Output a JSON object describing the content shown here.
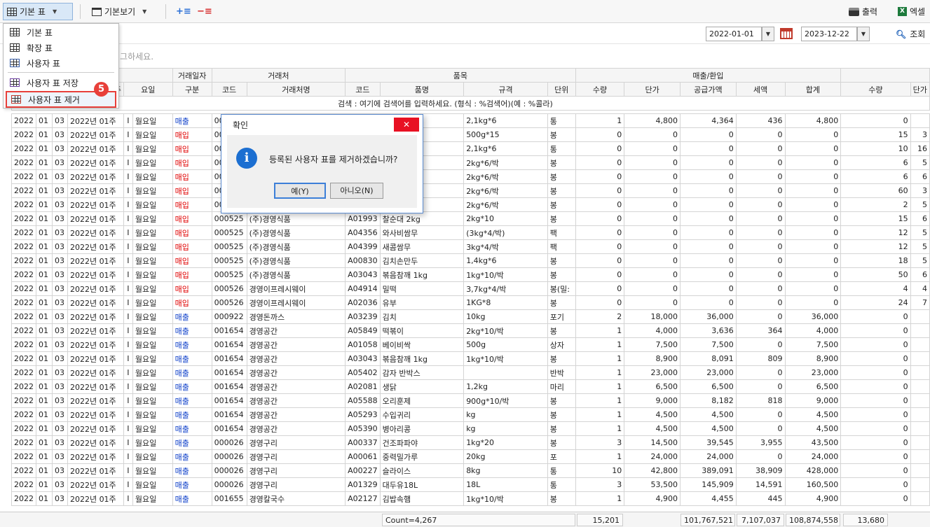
{
  "toolbar": {
    "table_label": "기본 표",
    "view_label": "기본보기",
    "print_label": "출력",
    "excel_label": "엑셀"
  },
  "date_filter": {
    "start": "2022-01-01",
    "end": "2023-12-22",
    "search_label": "조회"
  },
  "group_hint": "래그하세요.",
  "menu": {
    "items": [
      {
        "label": "기본 표"
      },
      {
        "label": "확장 표"
      },
      {
        "label": "사용자 표"
      },
      {
        "label": "사용자 표 저장"
      },
      {
        "label": "사용자 표 제거"
      }
    ],
    "step_badge": "5"
  },
  "table": {
    "group_headers": [
      "거래일자",
      "거래처",
      "품목",
      "매출/환입"
    ],
    "columns": [
      "주",
      "요일",
      "구분",
      "코드",
      "거래처명",
      "코드",
      "품명",
      "규격",
      "단위",
      "수량",
      "단가",
      "공급가액",
      "세액",
      "합계",
      "수량",
      "단가"
    ],
    "search_hint": "검색 : 여기에 검색어를 입력하세요. (형식 : %검색어)(예 : %콜라)",
    "rows": [
      [
        "2022",
        "01",
        "03",
        "2022년 01주",
        "I",
        "월요일",
        "매출",
        "000",
        "",
        "",
        "",
        "2,1kg*6",
        "통",
        "1",
        "4,800",
        "4,364",
        "436",
        "4,800",
        "0",
        ""
      ],
      [
        "2022",
        "01",
        "03",
        "2022년 01주",
        "I",
        "월요일",
        "매입",
        "000",
        "",
        "",
        "즈",
        "500g*15",
        "봉",
        "0",
        "0",
        "0",
        "0",
        "0",
        "15",
        "3"
      ],
      [
        "2022",
        "01",
        "03",
        "2022년 01주",
        "I",
        "월요일",
        "매입",
        "000",
        "",
        "",
        "",
        "2,1kg*6",
        "통",
        "0",
        "0",
        "0",
        "0",
        "0",
        "10",
        "16"
      ],
      [
        "2022",
        "01",
        "03",
        "2022년 01주",
        "I",
        "월요일",
        "매입",
        "000",
        "",
        "",
        "",
        "2kg*6/박",
        "봉",
        "0",
        "0",
        "0",
        "0",
        "0",
        "6",
        "5"
      ],
      [
        "2022",
        "01",
        "03",
        "2022년 01주",
        "I",
        "월요일",
        "매입",
        "000",
        "",
        "",
        "트",
        "2kg*6/박",
        "봉",
        "0",
        "0",
        "0",
        "0",
        "0",
        "6",
        "6"
      ],
      [
        "2022",
        "01",
        "03",
        "2022년 01주",
        "I",
        "월요일",
        "매입",
        "000",
        "",
        "",
        "타",
        "2kg*6/박",
        "봉",
        "0",
        "0",
        "0",
        "0",
        "0",
        "60",
        "3"
      ],
      [
        "2022",
        "01",
        "03",
        "2022년 01주",
        "I",
        "월요일",
        "매입",
        "000",
        "",
        "",
        "타",
        "2kg*6/박",
        "봉",
        "0",
        "0",
        "0",
        "0",
        "0",
        "2",
        "5"
      ],
      [
        "2022",
        "01",
        "03",
        "2022년 01주",
        "I",
        "월요일",
        "매입",
        "000525",
        "(주)경영식품",
        "A01993",
        "찰순대 2kg",
        "2kg*10",
        "봉",
        "0",
        "0",
        "0",
        "0",
        "0",
        "15",
        "6"
      ],
      [
        "2022",
        "01",
        "03",
        "2022년 01주",
        "I",
        "월요일",
        "매입",
        "000525",
        "(주)경영식품",
        "A04356",
        "와사비쌈무",
        "(3kg*4/박)",
        "팩",
        "0",
        "0",
        "0",
        "0",
        "0",
        "12",
        "5"
      ],
      [
        "2022",
        "01",
        "03",
        "2022년 01주",
        "I",
        "월요일",
        "매입",
        "000525",
        "(주)경영식품",
        "A04399",
        "새콤쌈무",
        "3kg*4/박",
        "팩",
        "0",
        "0",
        "0",
        "0",
        "0",
        "12",
        "5"
      ],
      [
        "2022",
        "01",
        "03",
        "2022년 01주",
        "I",
        "월요일",
        "매입",
        "000525",
        "(주)경영식품",
        "A00830",
        "김치손만두",
        "1,4kg*6",
        "봉",
        "0",
        "0",
        "0",
        "0",
        "0",
        "18",
        "5"
      ],
      [
        "2022",
        "01",
        "03",
        "2022년 01주",
        "I",
        "월요일",
        "매입",
        "000525",
        "(주)경영식품",
        "A03043",
        "볶음참깨 1kg",
        "1kg*10/박",
        "봉",
        "0",
        "0",
        "0",
        "0",
        "0",
        "50",
        "6"
      ],
      [
        "2022",
        "01",
        "03",
        "2022년 01주",
        "I",
        "월요일",
        "매입",
        "000526",
        "경영이프레시웨이",
        "A04914",
        "밀떡",
        "3,7kg*4/박",
        "봉(밀:",
        "0",
        "0",
        "0",
        "0",
        "0",
        "4",
        "4"
      ],
      [
        "2022",
        "01",
        "03",
        "2022년 01주",
        "I",
        "월요일",
        "매입",
        "000526",
        "경영이프레시웨이",
        "A02036",
        "유부",
        "1KG*8",
        "봉",
        "0",
        "0",
        "0",
        "0",
        "0",
        "24",
        "7"
      ],
      [
        "2022",
        "01",
        "03",
        "2022년 01주",
        "I",
        "월요일",
        "매출",
        "000922",
        "경영돈까스",
        "A03239",
        "김치",
        "10kg",
        "포기",
        "2",
        "18,000",
        "36,000",
        "0",
        "36,000",
        "0",
        ""
      ],
      [
        "2022",
        "01",
        "03",
        "2022년 01주",
        "I",
        "월요일",
        "매출",
        "001654",
        "경영공간",
        "A05849",
        "떡볶이",
        "2kg*10/박",
        "봉",
        "1",
        "4,000",
        "3,636",
        "364",
        "4,000",
        "0",
        ""
      ],
      [
        "2022",
        "01",
        "03",
        "2022년 01주",
        "I",
        "월요일",
        "매출",
        "001654",
        "경영공간",
        "A01058",
        "베이비싹",
        "500g",
        "상자",
        "1",
        "7,500",
        "7,500",
        "0",
        "7,500",
        "0",
        ""
      ],
      [
        "2022",
        "01",
        "03",
        "2022년 01주",
        "I",
        "월요일",
        "매출",
        "001654",
        "경영공간",
        "A03043",
        "볶음참깨 1kg",
        "1kg*10/박",
        "봉",
        "1",
        "8,900",
        "8,091",
        "809",
        "8,900",
        "0",
        ""
      ],
      [
        "2022",
        "01",
        "03",
        "2022년 01주",
        "I",
        "월요일",
        "매출",
        "001654",
        "경영공간",
        "A05402",
        "감자 반박스",
        "",
        "반박",
        "1",
        "23,000",
        "23,000",
        "0",
        "23,000",
        "0",
        ""
      ],
      [
        "2022",
        "01",
        "03",
        "2022년 01주",
        "I",
        "월요일",
        "매출",
        "001654",
        "경영공간",
        "A02081",
        "생닭",
        "1,2kg",
        "마리",
        "1",
        "6,500",
        "6,500",
        "0",
        "6,500",
        "0",
        ""
      ],
      [
        "2022",
        "01",
        "03",
        "2022년 01주",
        "I",
        "월요일",
        "매출",
        "001654",
        "경영공간",
        "A05588",
        "오리훈제",
        "900g*10/박",
        "봉",
        "1",
        "9,000",
        "8,182",
        "818",
        "9,000",
        "0",
        ""
      ],
      [
        "2022",
        "01",
        "03",
        "2022년 01주",
        "I",
        "월요일",
        "매출",
        "001654",
        "경영공간",
        "A05293",
        "수입귀리",
        "kg",
        "봉",
        "1",
        "4,500",
        "4,500",
        "0",
        "4,500",
        "0",
        ""
      ],
      [
        "2022",
        "01",
        "03",
        "2022년 01주",
        "I",
        "월요일",
        "매출",
        "001654",
        "경영공간",
        "A05390",
        "병아리콩",
        "kg",
        "봉",
        "1",
        "4,500",
        "4,500",
        "0",
        "4,500",
        "0",
        ""
      ],
      [
        "2022",
        "01",
        "03",
        "2022년 01주",
        "I",
        "월요일",
        "매출",
        "000026",
        "경영구리",
        "A00337",
        "건조파파야",
        "1kg*20",
        "봉",
        "3",
        "14,500",
        "39,545",
        "3,955",
        "43,500",
        "0",
        ""
      ],
      [
        "2022",
        "01",
        "03",
        "2022년 01주",
        "I",
        "월요일",
        "매출",
        "000026",
        "경영구리",
        "A00061",
        "중력밀가루",
        "20kg",
        "포",
        "1",
        "24,000",
        "24,000",
        "0",
        "24,000",
        "0",
        ""
      ],
      [
        "2022",
        "01",
        "03",
        "2022년 01주",
        "I",
        "월요일",
        "매출",
        "000026",
        "경영구리",
        "A00227",
        "슬라이스",
        "8kg",
        "통",
        "10",
        "42,800",
        "389,091",
        "38,909",
        "428,000",
        "0",
        ""
      ],
      [
        "2022",
        "01",
        "03",
        "2022년 01주",
        "I",
        "월요일",
        "매출",
        "000026",
        "경영구리",
        "A01329",
        "대두유18L",
        "18L",
        "통",
        "3",
        "53,500",
        "145,909",
        "14,591",
        "160,500",
        "0",
        ""
      ],
      [
        "2022",
        "01",
        "03",
        "2022년 01주",
        "I",
        "월요일",
        "매출",
        "001655",
        "경영칼국수",
        "A02127",
        "김밥속햄",
        "1kg*10/박",
        "봉",
        "1",
        "4,900",
        "4,455",
        "445",
        "4,900",
        "0",
        ""
      ]
    ]
  },
  "footer": {
    "count": "Count=4,267",
    "qty": "15,201",
    "supply": "101,767,521",
    "tax": "7,107,037",
    "total": "108,874,558",
    "qty2": "13,680"
  },
  "dialog": {
    "title": "확인",
    "message": "등록된 사용자 표를 제거하겠습니까?",
    "yes_label": "예(Y)",
    "no_label": "아니오(N)"
  }
}
